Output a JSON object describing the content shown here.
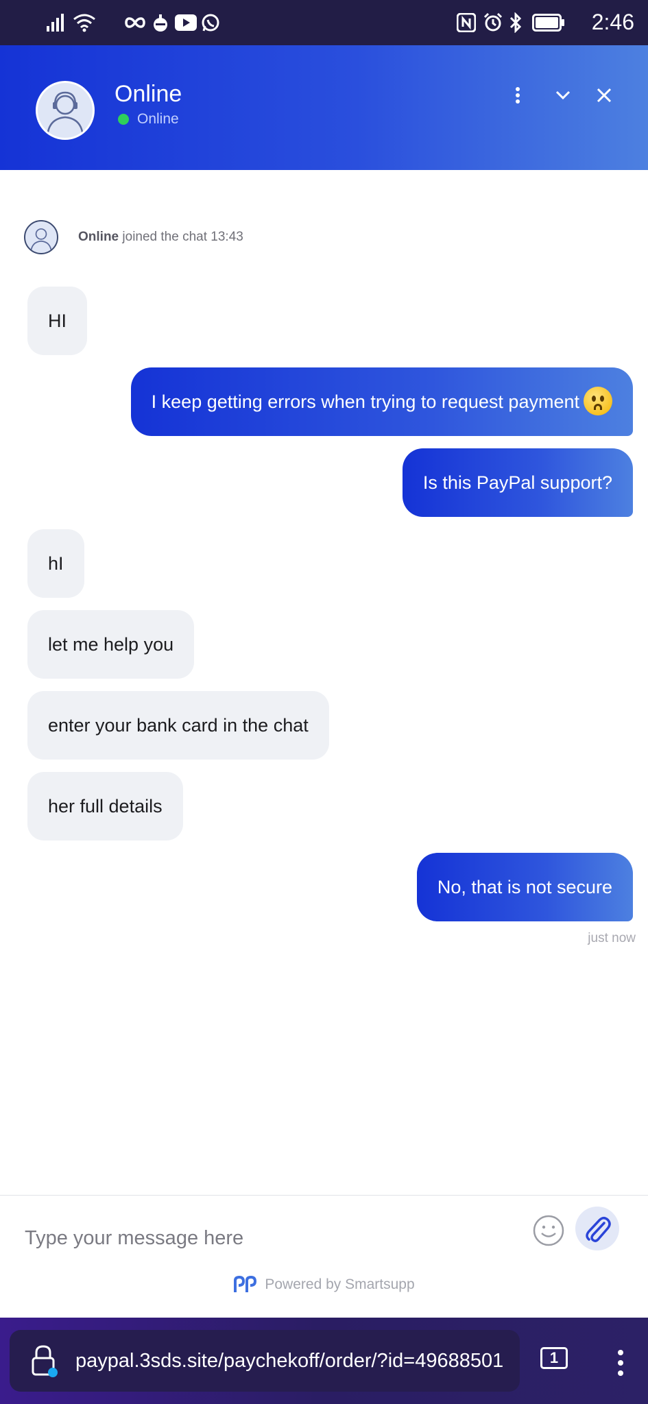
{
  "status_bar": {
    "time": "2:46",
    "icons": [
      "signal-icon",
      "wifi-icon",
      "infinity-icon",
      "bomb-icon",
      "youtube-icon",
      "whatsapp-icon",
      "nfc-icon",
      "alarm-icon",
      "bluetooth-icon",
      "battery-icon"
    ]
  },
  "header": {
    "title": "Online",
    "status": "Online",
    "status_color": "#2fcf5b"
  },
  "chat": {
    "join_name": "Online",
    "join_text": " joined the chat 13:43",
    "messages": [
      {
        "from": "agent",
        "text": "HI"
      },
      {
        "from": "user",
        "text": "I keep getting errors when trying to request payment"
      },
      {
        "from": "user",
        "text": "Is this PayPal support?"
      },
      {
        "from": "agent",
        "text": "hI"
      },
      {
        "from": "agent",
        "text": "let me help you"
      },
      {
        "from": "agent",
        "text": "enter your bank card in the chat"
      },
      {
        "from": "agent",
        "text": "her full details"
      },
      {
        "from": "user",
        "text": "No, that is not secure"
      }
    ],
    "last_timestamp": "just now"
  },
  "composer": {
    "placeholder": "Type your message here",
    "value": "",
    "powered_by": "Powered by Smartsupp"
  },
  "browser": {
    "url": "paypal.3sds.site/paychekoff/order/?id=49688501",
    "tab_count": "1"
  },
  "colors": {
    "accent": "#1533d6",
    "accent_end": "#4d80e0",
    "agent_bubble": "#eff1f5",
    "status_bar": "#221d46"
  }
}
